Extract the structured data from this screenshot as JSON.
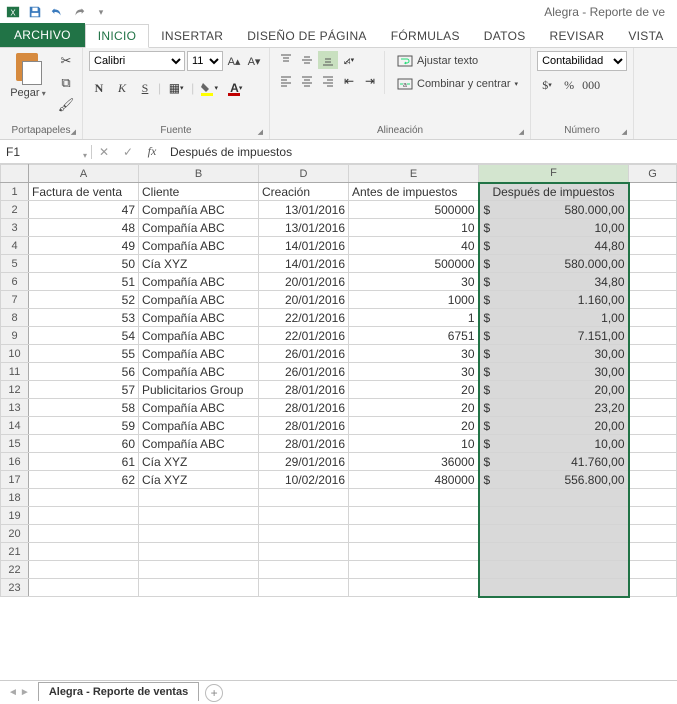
{
  "app": {
    "title": "Alegra - Reporte de ve"
  },
  "ribbon": {
    "tabs": {
      "file": "ARCHIVO",
      "home": "INICIO",
      "insert": "INSERTAR",
      "layout": "DISEÑO DE PÁGINA",
      "formulas": "FÓRMULAS",
      "data": "DATOS",
      "review": "REVISAR",
      "view": "VISTA"
    },
    "clipboard": {
      "paste": "Pegar",
      "group": "Portapapeles"
    },
    "font": {
      "name": "Calibri",
      "size": "11",
      "bold": "N",
      "italic": "K",
      "underline": "S",
      "group": "Fuente"
    },
    "align": {
      "wrap": "Ajustar texto",
      "merge": "Combinar y centrar",
      "group": "Alineación"
    },
    "number": {
      "format": "Contabilidad",
      "group": "Número"
    }
  },
  "formula_bar": {
    "name_box": "F1",
    "fx": "Después de impuestos"
  },
  "columns": [
    "A",
    "B",
    "D",
    "E",
    "F",
    "G"
  ],
  "selected_col": "F",
  "headers": {
    "a": "Factura de venta",
    "b": "Cliente",
    "d": "Creación",
    "e": "Antes de impuestos",
    "f": "Después de impuestos"
  },
  "rows": [
    {
      "n": "2",
      "a": "47",
      "b": "Compañía ABC",
      "d": "13/01/2016",
      "e": "500000",
      "f": "580.000,00"
    },
    {
      "n": "3",
      "a": "48",
      "b": "Compañía ABC",
      "d": "13/01/2016",
      "e": "10",
      "f": "10,00"
    },
    {
      "n": "4",
      "a": "49",
      "b": "Compañía ABC",
      "d": "14/01/2016",
      "e": "40",
      "f": "44,80"
    },
    {
      "n": "5",
      "a": "50",
      "b": "Cía XYZ",
      "d": "14/01/2016",
      "e": "500000",
      "f": "580.000,00"
    },
    {
      "n": "6",
      "a": "51",
      "b": "Compañía ABC",
      "d": "20/01/2016",
      "e": "30",
      "f": "34,80"
    },
    {
      "n": "7",
      "a": "52",
      "b": "Compañía ABC",
      "d": "20/01/2016",
      "e": "1000",
      "f": "1.160,00"
    },
    {
      "n": "8",
      "a": "53",
      "b": "Compañía ABC",
      "d": "22/01/2016",
      "e": "1",
      "f": "1,00"
    },
    {
      "n": "9",
      "a": "54",
      "b": "Compañía ABC",
      "d": "22/01/2016",
      "e": "6751",
      "f": "7.151,00"
    },
    {
      "n": "10",
      "a": "55",
      "b": "Compañía ABC",
      "d": "26/01/2016",
      "e": "30",
      "f": "30,00"
    },
    {
      "n": "11",
      "a": "56",
      "b": "Compañía ABC",
      "d": "26/01/2016",
      "e": "30",
      "f": "30,00"
    },
    {
      "n": "12",
      "a": "57",
      "b": "Publicitarios Group",
      "d": "28/01/2016",
      "e": "20",
      "f": "20,00"
    },
    {
      "n": "13",
      "a": "58",
      "b": "Compañía ABC",
      "d": "28/01/2016",
      "e": "20",
      "f": "23,20"
    },
    {
      "n": "14",
      "a": "59",
      "b": "Compañía ABC",
      "d": "28/01/2016",
      "e": "20",
      "f": "20,00"
    },
    {
      "n": "15",
      "a": "60",
      "b": "Compañía ABC",
      "d": "28/01/2016",
      "e": "10",
      "f": "10,00"
    },
    {
      "n": "16",
      "a": "61",
      "b": "Cía XYZ",
      "d": "29/01/2016",
      "e": "36000",
      "f": "41.760,00"
    },
    {
      "n": "17",
      "a": "62",
      "b": "Cía XYZ",
      "d": "10/02/2016",
      "e": "480000",
      "f": "556.800,00"
    }
  ],
  "empty_rows": [
    "18",
    "19",
    "20",
    "21",
    "22",
    "23"
  ],
  "sheet": {
    "name": "Alegra - Reporte de ventas"
  }
}
